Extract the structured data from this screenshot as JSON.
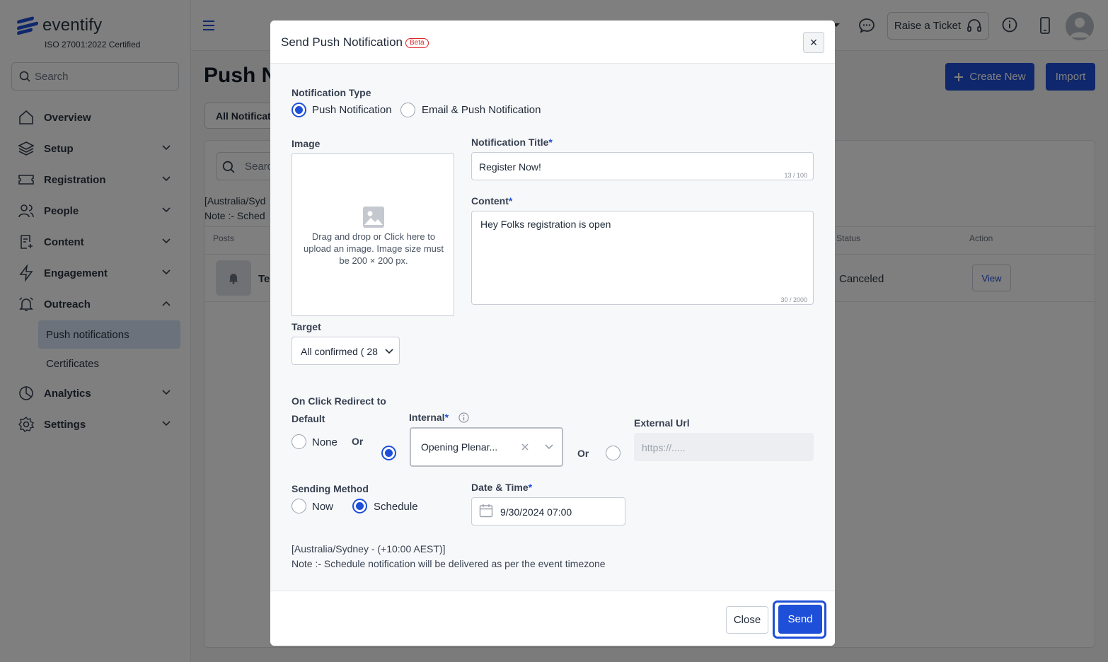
{
  "brand": {
    "name": "eventify",
    "certification": "ISO 27001:2022 Certified"
  },
  "sidebar": {
    "search_placeholder": "Search",
    "items": [
      {
        "label": "Overview"
      },
      {
        "label": "Setup"
      },
      {
        "label": "Registration"
      },
      {
        "label": "People"
      },
      {
        "label": "Content"
      },
      {
        "label": "Engagement"
      },
      {
        "label": "Outreach"
      },
      {
        "label": "Analytics"
      },
      {
        "label": "Settings"
      }
    ],
    "outreach_sub": [
      {
        "label": "Push notifications"
      },
      {
        "label": "Certificates"
      }
    ]
  },
  "topbar": {
    "raise_ticket": "Raise a Ticket"
  },
  "page": {
    "title": "Push N",
    "create_new": "Create New",
    "import": "Import",
    "tab_all": "All Notificat",
    "search_placeholder": "Searc",
    "tz_line": "[Australia/Syd",
    "note_line": "Note :- Sched",
    "columns": {
      "posts": "Posts",
      "status": "Status",
      "action": "Action"
    },
    "row": {
      "title": "Te",
      "status": "Canceled",
      "action": "View"
    }
  },
  "modal": {
    "title": "Send Push Notification",
    "badge": "Beta",
    "close_icon": "×",
    "notification_type_label": "Notification Type",
    "type_options": [
      "Push Notification",
      "Email & Push Notification"
    ],
    "selected_type": "Push Notification",
    "image_label": "Image",
    "image_hint": "Drag and drop or Click here to upload an image. Image size must be 200 × 200 px.",
    "title_label": "Notification Title",
    "title_value": "Register Now!",
    "title_counter": "13 / 100",
    "content_label": "Content",
    "content_value": "Hey Folks registration is open",
    "content_counter": "30 / 2000",
    "target_label": "Target",
    "target_value": "All confirmed ( 28",
    "redirect_label": "On Click Redirect to",
    "default_label": "Default",
    "none_label": "None",
    "or_label": "Or",
    "internal_label": "Internal",
    "internal_value": "Opening Plenar...",
    "external_label": "External Url",
    "external_placeholder": "https://.....",
    "sending_method_label": "Sending Method",
    "method_options": [
      "Now",
      "Schedule"
    ],
    "selected_method": "Schedule",
    "datetime_label": "Date & Time",
    "datetime_value": "9/30/2024 07:00",
    "timezone": "[Australia/Sydney - (+10:00 AEST)]",
    "note": "Note :- Schedule notification will be delivered as per the event timezone",
    "close_button": "Close",
    "send_button": "Send"
  },
  "colors": {
    "accent": "#1e4fd8",
    "badge": "#e02424",
    "overlay": "rgba(0,0,0,0.5)"
  }
}
